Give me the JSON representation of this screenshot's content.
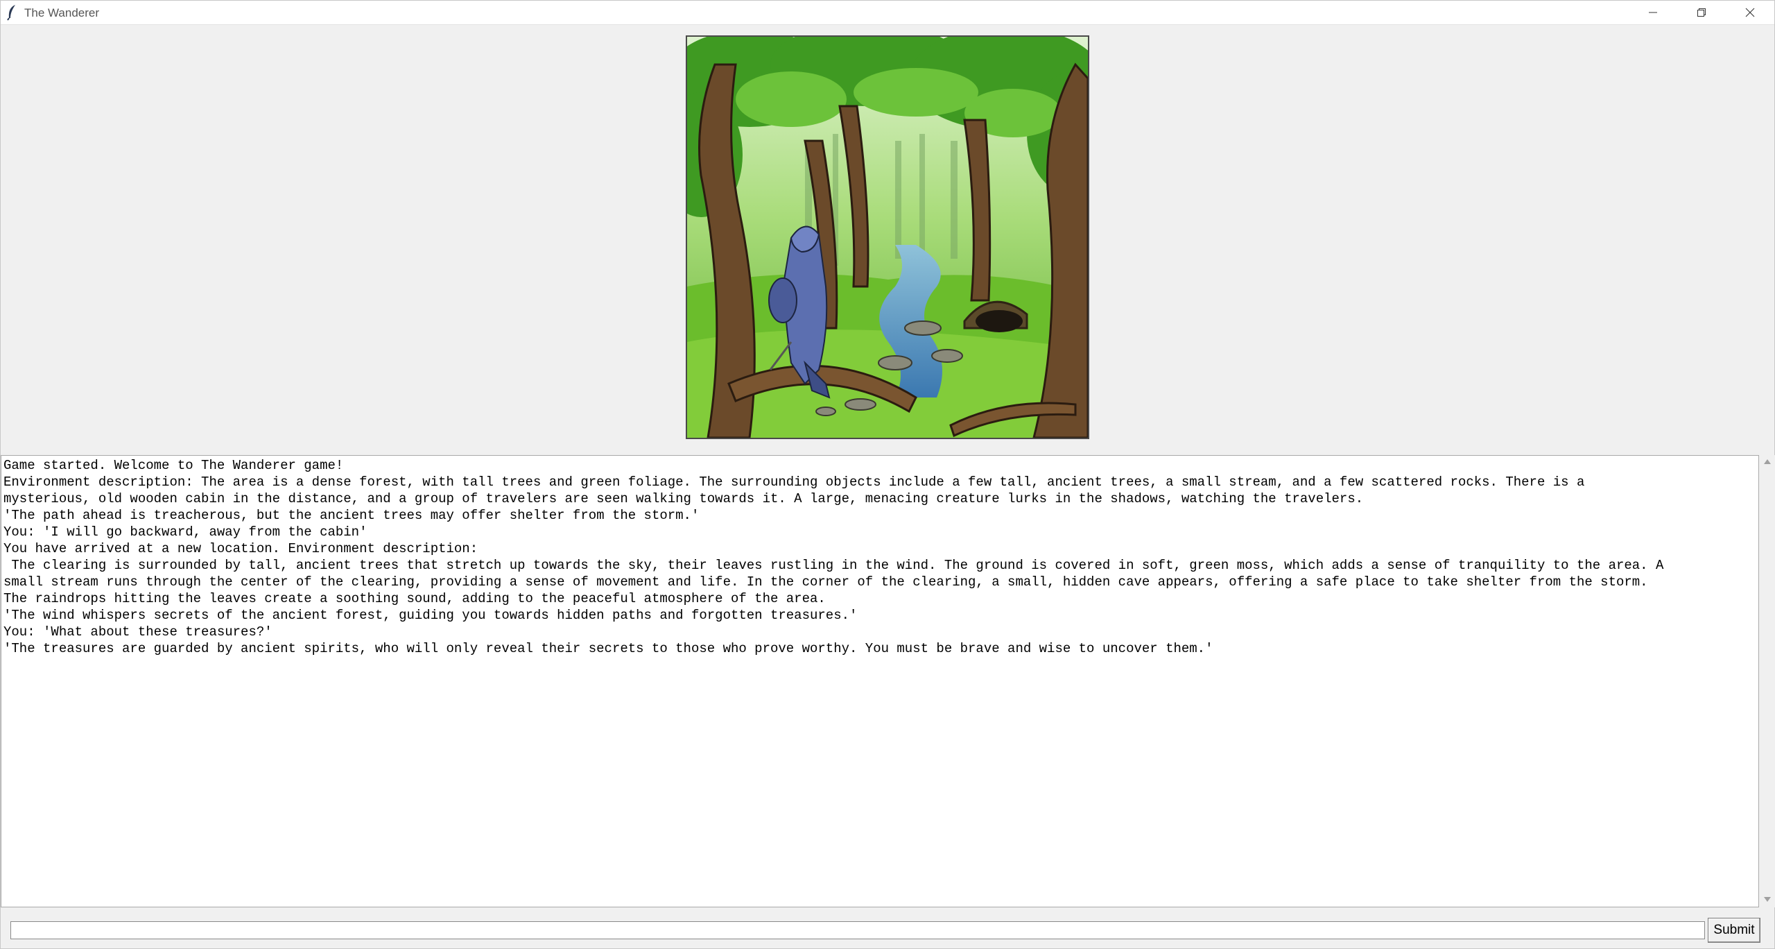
{
  "window": {
    "title": "The Wanderer",
    "controls": {
      "minimize": "minimize-icon",
      "maximize": "restore-icon",
      "close": "close-icon"
    }
  },
  "scene": {
    "icon": "forest-scene-image"
  },
  "log": {
    "lines": [
      "Game started. Welcome to The Wanderer game!",
      "Environment description: The area is a dense forest, with tall trees and green foliage. The surrounding objects include a few tall, ancient trees, a small stream, and a few scattered rocks. There is a",
      "mysterious, old wooden cabin in the distance, and a group of travelers are seen walking towards it. A large, menacing creature lurks in the shadows, watching the travelers.",
      "'The path ahead is treacherous, but the ancient trees may offer shelter from the storm.'",
      "You: 'I will go backward, away from the cabin'",
      "You have arrived at a new location. Environment description:",
      " The clearing is surrounded by tall, ancient trees that stretch up towards the sky, their leaves rustling in the wind. The ground is covered in soft, green moss, which adds a sense of tranquility to the area. A",
      "small stream runs through the center of the clearing, providing a sense of movement and life. In the corner of the clearing, a small, hidden cave appears, offering a safe place to take shelter from the storm.",
      "The raindrops hitting the leaves create a soothing sound, adding to the peaceful atmosphere of the area.",
      "'The wind whispers secrets of the ancient forest, guiding you towards hidden paths and forgotten treasures.'",
      "You: 'What about these treasures?'",
      "'The treasures are guarded by ancient spirits, who will only reveal their secrets to those who prove worthy. You must be brave and wise to uncover them.'"
    ]
  },
  "input": {
    "value": "",
    "submit_label": "Submit"
  }
}
